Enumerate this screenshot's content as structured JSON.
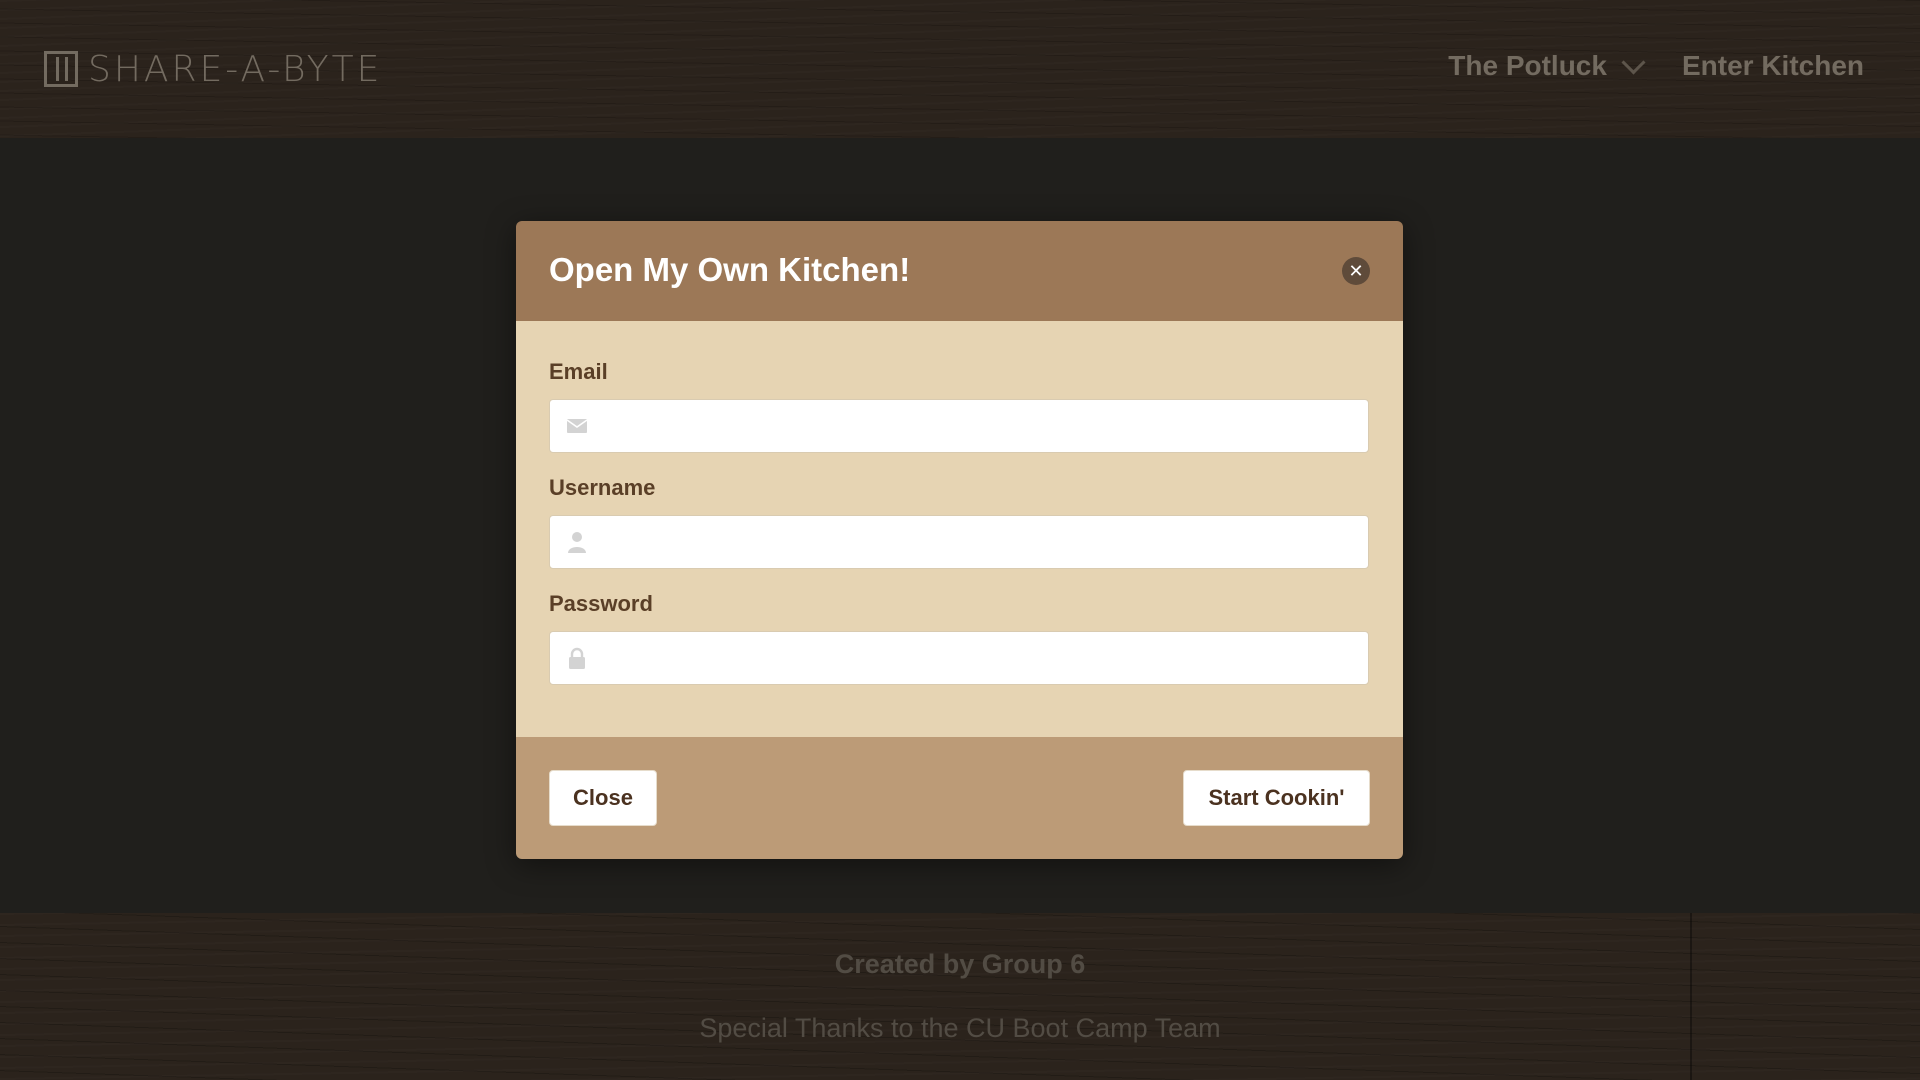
{
  "navbar": {
    "brand": "SHARE-A-BYTE",
    "links": [
      {
        "label": "The Potluck",
        "has_dropdown": true
      },
      {
        "label": "Enter Kitchen",
        "has_dropdown": false
      }
    ]
  },
  "modal": {
    "title": "Open My Own Kitchen!",
    "fields": [
      {
        "label": "Email",
        "value": "",
        "icon": "envelope-icon"
      },
      {
        "label": "Username",
        "value": "",
        "icon": "user-icon"
      },
      {
        "label": "Password",
        "value": "",
        "icon": "lock-icon"
      }
    ],
    "close_button": "Close",
    "submit_button": "Start Cookin'"
  },
  "footer": {
    "credit": "Created by Group 6",
    "thanks": "Special Thanks to the CU Boot Camp Team"
  },
  "colors": {
    "modal_header": "#9c7857",
    "modal_body": "#e6d4b3",
    "modal_footer": "#bc9b77",
    "label_text": "#5a3f27",
    "page_background": "#2b2a26"
  }
}
